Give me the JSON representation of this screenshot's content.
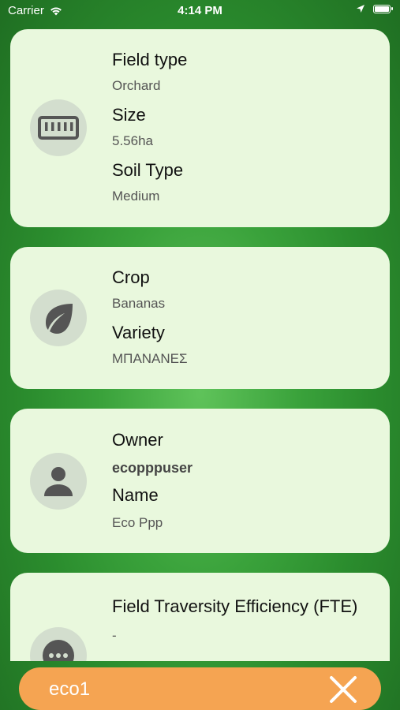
{
  "status_bar": {
    "carrier": "Carrier",
    "time": "4:14 PM"
  },
  "cards": [
    {
      "icon": "ruler-icon",
      "fields": [
        {
          "label": "Field type",
          "value": "Orchard"
        },
        {
          "label": "Size",
          "value": "5.56ha"
        },
        {
          "label": "Soil Type",
          "value": "Medium"
        }
      ]
    },
    {
      "icon": "leaf-icon",
      "fields": [
        {
          "label": "Crop",
          "value": "Bananas"
        },
        {
          "label": "Variety",
          "value": "ΜΠΑΝΑΝΕΣ"
        }
      ]
    },
    {
      "icon": "person-icon",
      "fields": [
        {
          "label": "Owner",
          "value": "ecopppuser"
        },
        {
          "label": "Name",
          "value": "Eco Ppp"
        }
      ]
    },
    {
      "icon": "more-icon",
      "fields": [
        {
          "label": "Field Traversity Efficiency (FTE)",
          "value": "-"
        }
      ]
    }
  ],
  "bottom_bar": {
    "text": "eco1",
    "close_icon": "close-icon"
  },
  "colors": {
    "card_bg": "#e9f8dd",
    "icon_circle": "#d3dece",
    "bottom_bar": "#f5a452",
    "background_green": "#3aa23b"
  }
}
